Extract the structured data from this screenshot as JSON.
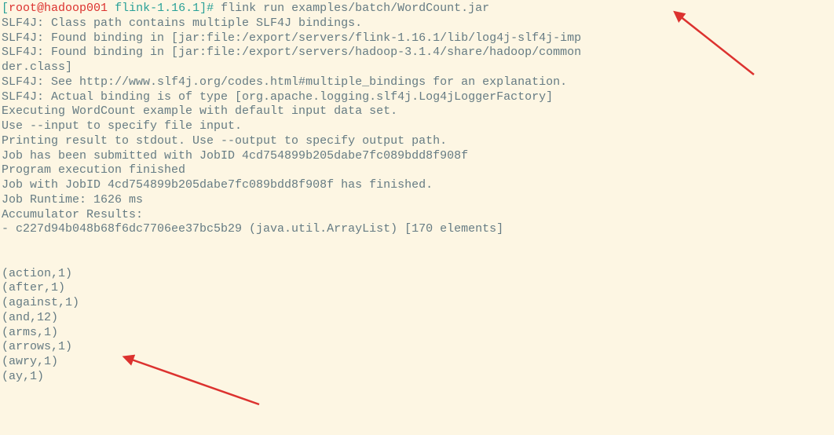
{
  "prompt": {
    "open_bracket": "[",
    "user": "root",
    "at": "@",
    "host": "hadoop001",
    "path": " flink-1.16.1",
    "close_bracket": "]",
    "hash": "# "
  },
  "command": "flink run examples/batch/WordCount.jar",
  "output_lines": [
    "SLF4J: Class path contains multiple SLF4J bindings.",
    "SLF4J: Found binding in [jar:file:/export/servers/flink-1.16.1/lib/log4j-slf4j-imp",
    "SLF4J: Found binding in [jar:file:/export/servers/hadoop-3.1.4/share/hadoop/common",
    "der.class]",
    "SLF4J: See http://www.slf4j.org/codes.html#multiple_bindings for an explanation.",
    "SLF4J: Actual binding is of type [org.apache.logging.slf4j.Log4jLoggerFactory]",
    "Executing WordCount example with default input data set.",
    "Use --input to specify file input.",
    "Printing result to stdout. Use --output to specify output path.",
    "Job has been submitted with JobID 4cd754899b205dabe7fc089bdd8f908f",
    "Program execution finished",
    "Job with JobID 4cd754899b205dabe7fc089bdd8f908f has finished.",
    "Job Runtime: 1626 ms",
    "Accumulator Results:",
    "- c227d94b048b68f6dc7706ee37bc5b29 (java.util.ArrayList) [170 elements]"
  ],
  "word_results": [
    "(action,1)",
    "(after,1)",
    "(against,1)",
    "(and,12)",
    "(arms,1)",
    "(arrows,1)",
    "(awry,1)",
    "(ay,1)"
  ]
}
